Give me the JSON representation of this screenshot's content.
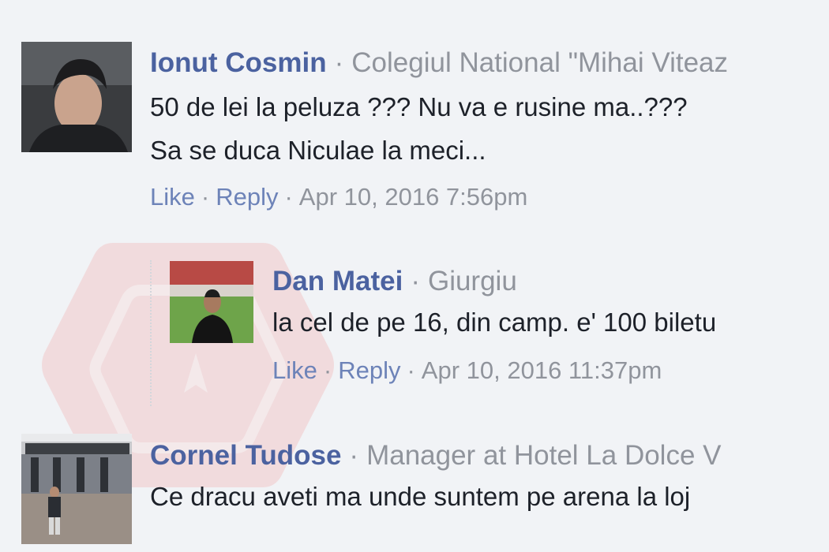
{
  "comments": [
    {
      "author": "Ionut Cosmin",
      "affiliation": "Colegiul National \"Mihai Viteaz",
      "text_lines": [
        "50 de lei la peluza ??? Nu va e rusine ma..???",
        "Sa se duca Niculae la meci..."
      ],
      "like": "Like",
      "reply": "Reply",
      "timestamp": "Apr 10, 2016 7:56pm"
    },
    {
      "author": "Dan Matei",
      "affiliation": "Giurgiu",
      "text_lines": [
        "la cel de pe 16, din camp. e' 100 biletu"
      ],
      "like": "Like",
      "reply": "Reply",
      "timestamp": "Apr 10, 2016 11:37pm"
    },
    {
      "author": "Cornel Tudose",
      "affiliation": "Manager at Hotel La Dolce V",
      "text_lines": [
        "Ce dracu aveti ma unde suntem pe arena la loj"
      ]
    }
  ],
  "separator": "·",
  "colors": {
    "background": "#f1f3f6",
    "author": "#4b62a0",
    "meta": "#90949c",
    "text": "#1d2129",
    "action": "#6d83b8"
  }
}
